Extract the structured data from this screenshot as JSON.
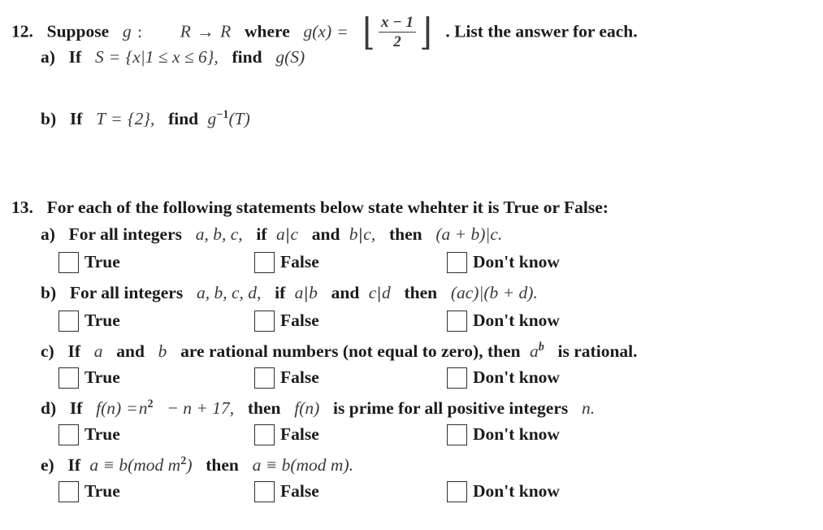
{
  "document": {
    "type": "math-worksheet",
    "background_color": "#ffffff",
    "text_color": "#1b1b1b",
    "math_color": "#3a3a3a"
  },
  "questions": [
    {
      "number": "12.",
      "stem_prefix": "Suppose",
      "stem_function": "g",
      "stem_colon": ":",
      "stem_domain": "R",
      "stem_arrow": "→",
      "stem_codomain": "R",
      "stem_where": "where",
      "stem_gx": "g(x)",
      "stem_equals": "=",
      "floor_left": "⌊",
      "floor_right": "⌋",
      "frac_numerator": "x − 1",
      "frac_denominator": "2",
      "stem_suffix": ". List the answer for each.",
      "parts": [
        {
          "label": "a)",
          "text_if": "If",
          "set_name": "S",
          "equals": "=",
          "set_body": "{x|1 ≤ x ≤ 6},",
          "find": "find",
          "target": "g(S)"
        },
        {
          "label": "b)",
          "text_if": "If",
          "set_name": "T",
          "equals": "=",
          "set_body": "{2},",
          "find": "find",
          "target_fn": "g",
          "target_sup": "−1",
          "target_arg": "(T)"
        }
      ]
    },
    {
      "number": "13.",
      "stem": "For each of the following statements below state whehter it is True or False:",
      "parts": [
        {
          "label": "a)",
          "lead": "For all integers",
          "vars": "a, b, c,",
          "if_word": "if",
          "cond1_a": "a",
          "cond1_bar": "|",
          "cond1_b": "c",
          "and_word": "and",
          "cond2_a": "b",
          "cond2_bar": "|",
          "cond2_b": "c,",
          "then_word": "then",
          "conclusion": "(a + b)|c."
        },
        {
          "label": "b)",
          "lead": "For all integers",
          "vars": "a, b, c, d,",
          "if_word": "if",
          "cond1_a": "a",
          "cond1_bar": "|",
          "cond1_b": "b",
          "and_word": "and",
          "cond2_a": "c",
          "cond2_bar": "|",
          "cond2_b": "d",
          "then_word": "then",
          "conclusion": "(ac)|(b + d)."
        },
        {
          "label": "c)",
          "if_word": "If",
          "var_a": "a",
          "and_word": "and",
          "var_b": "b",
          "mid_text": "are rational numbers (not equal to zero), then",
          "expr_base": "a",
          "expr_sup": "b",
          "tail_text": "is rational."
        },
        {
          "label": "d)",
          "if_word": "If",
          "expr_lhs": "f(n)",
          "equals": "=",
          "expr_n": "n",
          "expr_sup": "2",
          "expr_rest": "− n + 17,",
          "then_word": "then",
          "expr_fn": "f(n)",
          "tail_text": "is prime for all positive integers",
          "tail_var": "n."
        },
        {
          "label": "e)",
          "if_word": "If",
          "lhs_a": "a ≡ b(mod m",
          "lhs_sup": "2",
          "lhs_close": ")",
          "then_word": "then",
          "rhs": "a ≡ b(mod m)."
        }
      ]
    }
  ],
  "checkbox_options": [
    {
      "id": "true",
      "label": "True"
    },
    {
      "id": "false",
      "label": "False"
    },
    {
      "id": "dont-know",
      "label": "Don't know"
    }
  ]
}
